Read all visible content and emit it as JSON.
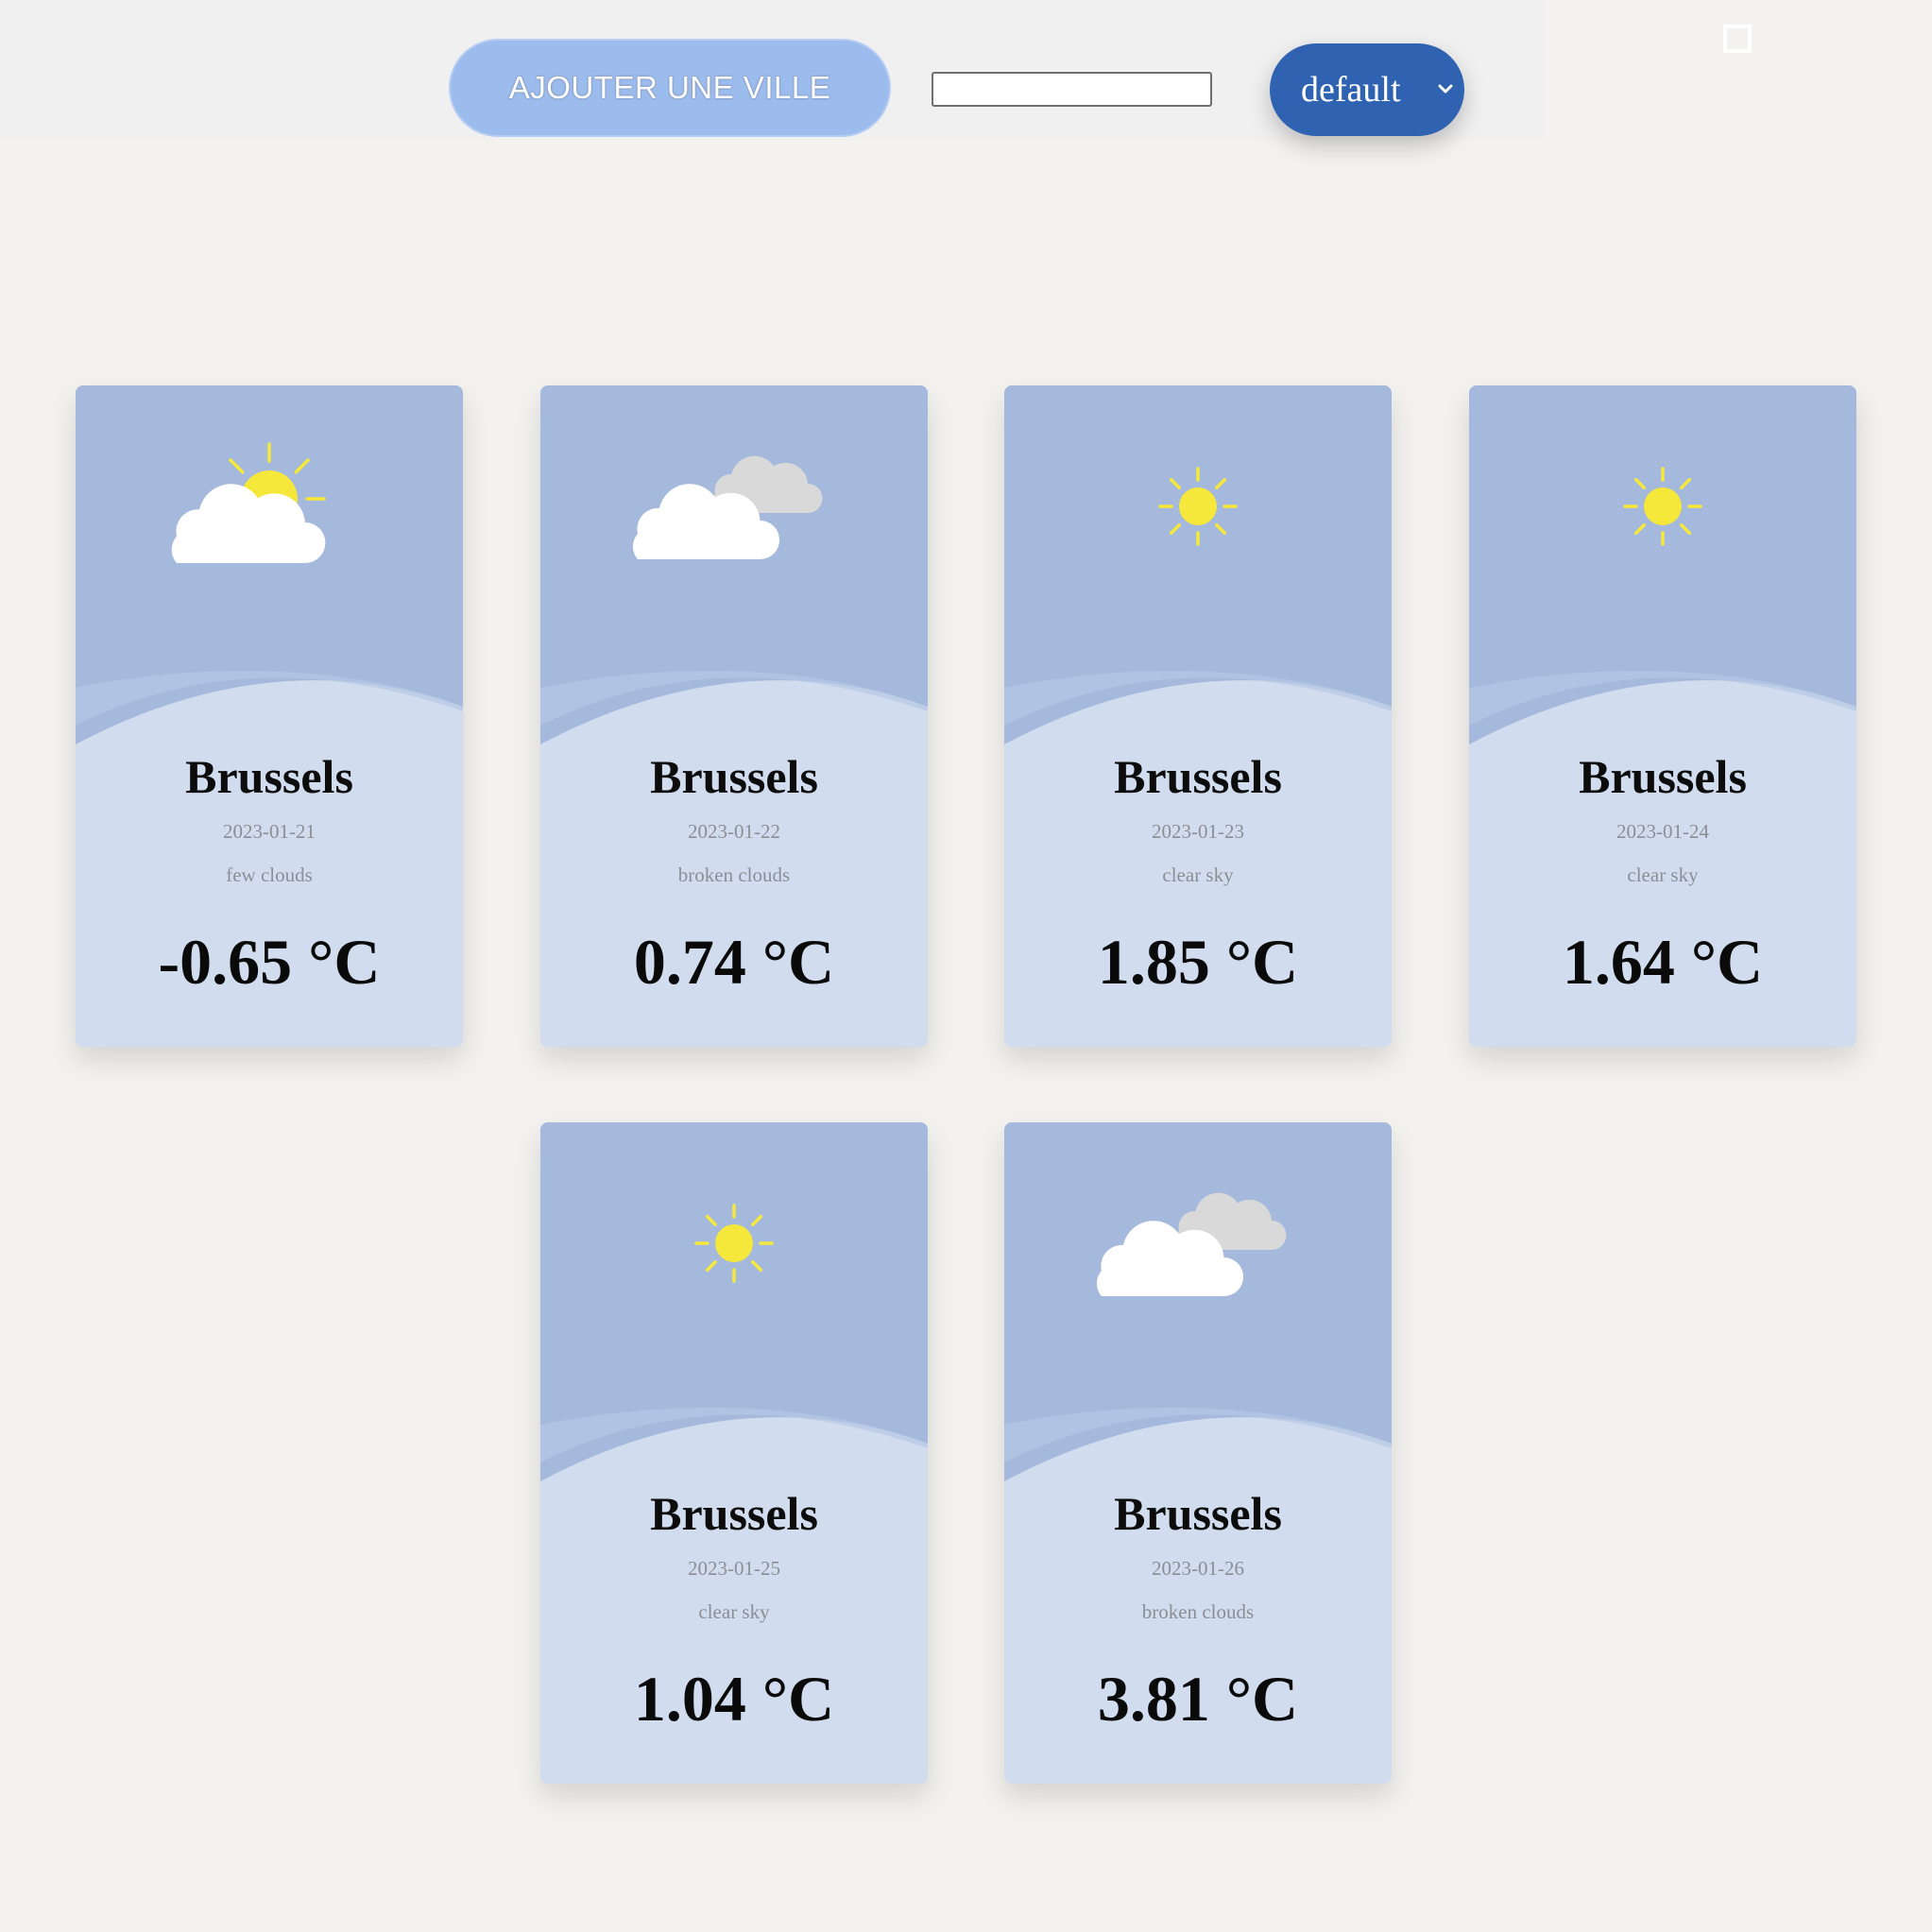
{
  "toolbar": {
    "add_city_label": "AJOUTER UNE VILLE",
    "city_input_value": "",
    "unit_select_value": "default"
  },
  "cards": [
    {
      "city": "Brussels",
      "date": "2023-01-21",
      "description": "few clouds",
      "temperature": "-0.65 °C",
      "icon": "sun-behind-cloud-icon"
    },
    {
      "city": "Brussels",
      "date": "2023-01-22",
      "description": "broken clouds",
      "temperature": "0.74 °C",
      "icon": "broken-clouds-icon"
    },
    {
      "city": "Brussels",
      "date": "2023-01-23",
      "description": "clear sky",
      "temperature": "1.85 °C",
      "icon": "sun-icon"
    },
    {
      "city": "Brussels",
      "date": "2023-01-24",
      "description": "clear sky",
      "temperature": "1.64 °C",
      "icon": "sun-icon"
    },
    {
      "city": "Brussels",
      "date": "2023-01-25",
      "description": "clear sky",
      "temperature": "1.04 °C",
      "icon": "sun-icon"
    },
    {
      "city": "Brussels",
      "date": "2023-01-26",
      "description": "broken clouds",
      "temperature": "3.81 °C",
      "icon": "broken-clouds-icon"
    }
  ],
  "colors": {
    "card_top": "#a5b9dc",
    "card_bottom": "#d1ddee",
    "accent_button": "#9dbcee",
    "select_bg": "#2f63b1",
    "sun": "#f6e83b",
    "cloud_front": "#ffffff",
    "cloud_back": "#d9d9d9"
  }
}
